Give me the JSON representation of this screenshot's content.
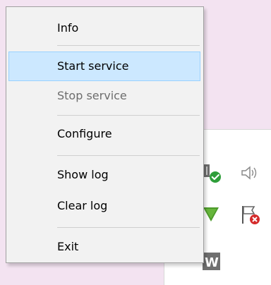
{
  "menu": {
    "items": [
      {
        "label": "Info",
        "state": "normal"
      },
      {
        "label": "Start service",
        "state": "highlighted"
      },
      {
        "label": "Stop service",
        "state": "disabled"
      },
      {
        "label": "Configure",
        "state": "normal"
      },
      {
        "label": "Show log",
        "state": "normal"
      },
      {
        "label": "Clear log",
        "state": "normal"
      },
      {
        "label": "Exit",
        "state": "normal"
      }
    ]
  },
  "tray": {
    "icons": [
      {
        "name": "network-check-icon",
        "badge_color": "#2e9e3a"
      },
      {
        "name": "speaker-icon",
        "badge_color": "#7a7a7a"
      },
      {
        "name": "green-arrow-icon",
        "badge_color": "#4c9a2a"
      },
      {
        "name": "flag-error-icon",
        "badge_color": "#d42b2b"
      },
      {
        "name": "w-app-icon",
        "badge_color": "#6f6f6f"
      }
    ]
  },
  "colors": {
    "background": "#f3e3f1",
    "menu_background": "#f2f2f2",
    "highlight_background": "#cce8ff",
    "highlight_border": "#99d1ff",
    "disabled_text": "#6d6d6d"
  }
}
